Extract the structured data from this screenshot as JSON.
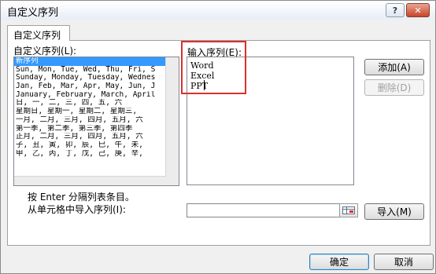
{
  "dialog": {
    "title": "自定义序列"
  },
  "titlebar": {
    "help_label": "?",
    "close_label": "✕"
  },
  "tab": {
    "label": "自定义序列"
  },
  "custom_list": {
    "label": "自定义序列(L):",
    "items": [
      "新序列",
      "Sun, Mon, Tue, Wed, Thu, Fri, S",
      "Sunday, Monday, Tuesday, Wednes",
      "Jan, Feb, Mar, Apr, May, Jun, J",
      "January, February, March, April",
      "日, 一, 二, 三, 四, 五, 六",
      "星期日, 星期一, 星期二, 星期三,",
      "一月, 二月, 三月, 四月, 五月, 六",
      "第一季, 第二季, 第三季, 第四季",
      "正月, 二月, 三月, 四月, 五月, 六",
      "子, 丑, 寅, 卯, 辰, 巳, 午, 未,",
      "甲, 乙, 丙, 丁, 戊, 己, 庚, 辛,"
    ]
  },
  "input_sequence": {
    "label": "输入序列(E):",
    "lines": [
      "Word",
      "Excel",
      "PPT"
    ]
  },
  "buttons": {
    "add": "添加(A)",
    "delete": "删除(D)",
    "import": "导入(M)",
    "ok": "确定",
    "cancel": "取消"
  },
  "hint": "按 Enter 分隔列表条目。",
  "import": {
    "label": "从单元格中导入序列(I):",
    "value": ""
  }
}
